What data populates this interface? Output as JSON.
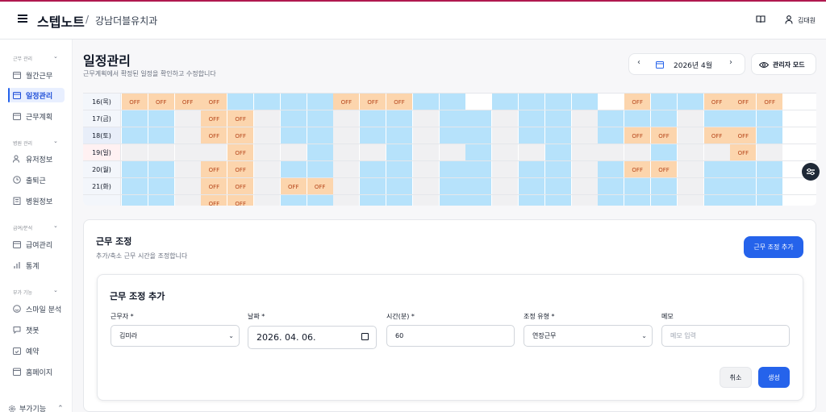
{
  "header": {
    "brand": "스텝노트",
    "separator": "/",
    "clinic": "강남더블유치과",
    "username": "김대원"
  },
  "sidebar": {
    "sections": [
      {
        "label": "근무 관리",
        "items": [
          {
            "label": "월간근무",
            "icon": "calendar-icon"
          },
          {
            "label": "일정관리",
            "icon": "calendar-edit-icon",
            "active": true
          },
          {
            "label": "근무계획",
            "icon": "calendar-plan-icon"
          }
        ]
      },
      {
        "label": "병원 관리",
        "items": [
          {
            "label": "유저정보",
            "icon": "users-icon"
          },
          {
            "label": "출퇴근",
            "icon": "clock-icon"
          },
          {
            "label": "병원정보",
            "icon": "hospital-icon"
          }
        ]
      },
      {
        "label": "급여/분석",
        "items": [
          {
            "label": "급여관리",
            "icon": "wallet-icon"
          },
          {
            "label": "통계",
            "icon": "bar-chart-icon"
          }
        ]
      },
      {
        "label": "부가 기능",
        "items": [
          {
            "label": "스마일 분석",
            "icon": "smile-icon"
          },
          {
            "label": "챗봇",
            "icon": "chat-icon"
          },
          {
            "label": "예약",
            "icon": "calendar-check-icon"
          },
          {
            "label": "홈페이지",
            "icon": "web-icon"
          }
        ]
      }
    ],
    "bottom": {
      "label": "부가기능",
      "icon": "gear-icon"
    }
  },
  "page": {
    "title": "일정관리",
    "subtitle": "근무계획에서 확정된 일정을 확인하고 수정합니다",
    "month": "2026년 4월",
    "admin_mode": "관리자 모드"
  },
  "schedule": {
    "off_label": "OFF",
    "rows": [
      {
        "label": "16(목)",
        "kind": "weekday",
        "cells": [
          "O",
          "O",
          "O",
          "O",
          "W",
          "W",
          "W",
          "W",
          "O",
          "O",
          "O",
          "W",
          "W",
          "E",
          "W",
          "W",
          "W",
          "W",
          "E",
          "O",
          "W",
          "W",
          "O",
          "O",
          "O"
        ]
      },
      {
        "label": "17(금)",
        "kind": "weekday",
        "cells": [
          "W",
          "W",
          "G",
          "O",
          "O",
          "G",
          "W",
          "W",
          "G",
          "W",
          "W",
          "G",
          "W",
          "W",
          "G",
          "W",
          "W",
          "G",
          "W",
          "W",
          "W",
          "G",
          "W",
          "W",
          "W"
        ]
      },
      {
        "label": "18(토)",
        "kind": "sat",
        "cells": [
          "W",
          "W",
          "G",
          "O",
          "O",
          "G",
          "W",
          "W",
          "G",
          "W",
          "W",
          "G",
          "W",
          "W",
          "G",
          "W",
          "W",
          "G",
          "W",
          "O",
          "O",
          "G",
          "O",
          "O",
          "W"
        ]
      },
      {
        "label": "19(일)",
        "kind": "sun",
        "cells": [
          "G",
          "G",
          "G",
          "G",
          "O",
          "G",
          "G",
          "W",
          "G",
          "G",
          "W",
          "G",
          "G",
          "W",
          "G",
          "G",
          "W",
          "G",
          "G",
          "G",
          "W",
          "G",
          "G",
          "O",
          "G"
        ]
      },
      {
        "label": "20(월)",
        "kind": "weekday",
        "cells": [
          "W",
          "W",
          "G",
          "O",
          "O",
          "G",
          "W",
          "W",
          "G",
          "W",
          "W",
          "G",
          "W",
          "W",
          "G",
          "W",
          "W",
          "G",
          "W",
          "O",
          "O",
          "G",
          "W",
          "W",
          "W"
        ]
      },
      {
        "label": "21(화)",
        "kind": "weekday",
        "cells": [
          "W",
          "W",
          "G",
          "O",
          "O",
          "G",
          "O",
          "O",
          "G",
          "W",
          "W",
          "G",
          "W",
          "W",
          "G",
          "W",
          "W",
          "G",
          "W",
          "W",
          "W",
          "G",
          "W",
          "W",
          "W"
        ]
      },
      {
        "label": "",
        "kind": "weekday",
        "cells": [
          "W",
          "W",
          "G",
          "O",
          "O",
          "G",
          "W",
          "W",
          "G",
          "W",
          "W",
          "G",
          "W",
          "W",
          "G",
          "W",
          "W",
          "G",
          "W",
          "W",
          "W",
          "G",
          "W",
          "W",
          "W"
        ]
      }
    ]
  },
  "adjust": {
    "title": "근무 조정",
    "subtitle": "추가/축소 근무 시간을 조정합니다",
    "add_button": "근무 조정 추가",
    "form": {
      "title": "근무 조정 추가",
      "worker_label": "근무자 *",
      "worker_value": "김미라",
      "date_label": "날짜 *",
      "date_value": "2026. 04. 06.",
      "minutes_label": "시간(분) *",
      "minutes_value": "60",
      "type_label": "조정 유형 *",
      "type_value": "연장근무",
      "memo_label": "메모",
      "memo_placeholder": "메모 입력",
      "cancel": "취소",
      "create": "생성"
    }
  },
  "colors": {
    "off": "#fcd5ad",
    "work": "#b6e2fb",
    "accent": "#2563eb",
    "brand_line": "#b0194f"
  }
}
